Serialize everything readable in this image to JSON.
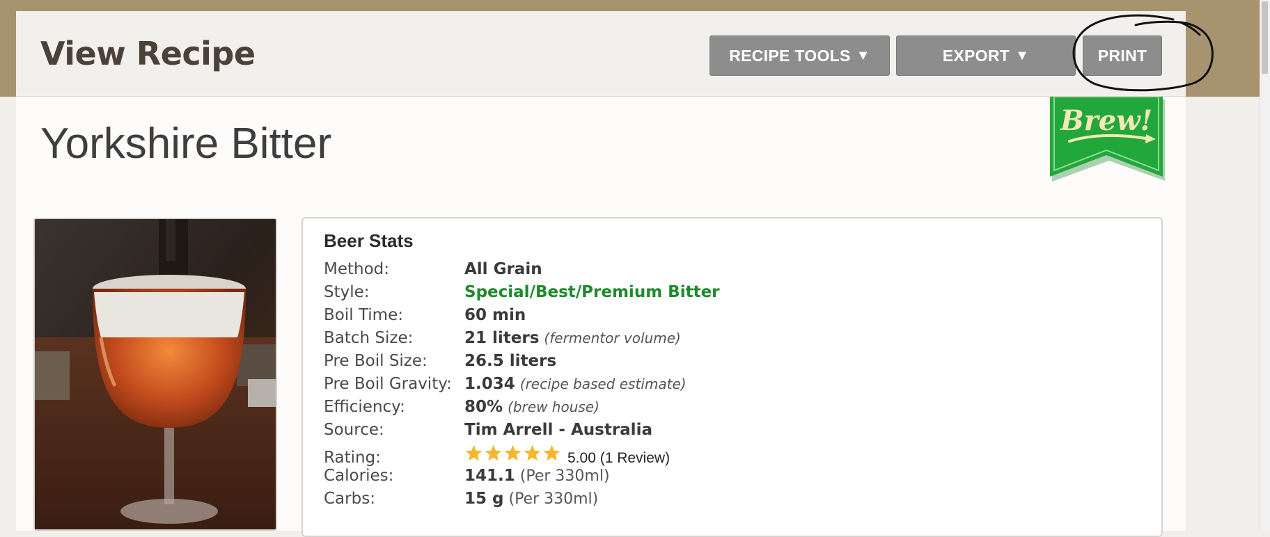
{
  "header": {
    "title": "View Recipe",
    "buttons": {
      "recipe_tools": "RECIPE TOOLS",
      "export": "EXPORT",
      "print": "PRINT"
    },
    "caret_glyph": "▼"
  },
  "recipe": {
    "title": "Yorkshire Bitter",
    "badge": "Brew!"
  },
  "stats": {
    "heading": "Beer Stats",
    "method": {
      "label": "Method:",
      "value": "All Grain"
    },
    "style": {
      "label": "Style:",
      "value": "Special/Best/Premium Bitter"
    },
    "boil_time": {
      "label": "Boil Time:",
      "value": "60 min"
    },
    "batch_size": {
      "label": "Batch Size:",
      "value": "21 liters",
      "note": "(fermentor volume)"
    },
    "pre_boil_size": {
      "label": "Pre Boil Size:",
      "value": "26.5 liters"
    },
    "pre_boil_gravity": {
      "label": "Pre Boil Gravity:",
      "value": "1.034",
      "note": "(recipe based estimate)"
    },
    "efficiency": {
      "label": "Efficiency:",
      "value": "80%",
      "note": "(brew house)"
    },
    "source": {
      "label": "Source:",
      "value": "Tim Arrell - Australia"
    },
    "rating": {
      "label": "Rating:",
      "stars": 5,
      "text": "5.00 (1 Review)"
    },
    "calories": {
      "label": "Calories:",
      "value": "141.1",
      "note": "(Per 330ml)"
    },
    "carbs": {
      "label": "Carbs:",
      "value": "15 g",
      "note": "(Per 330ml)"
    }
  },
  "colors": {
    "band": "#a89371",
    "button": "#8d8d8d",
    "link_green": "#1e8a2c",
    "star": "#f5b731",
    "ribbon": "#22a83a"
  }
}
